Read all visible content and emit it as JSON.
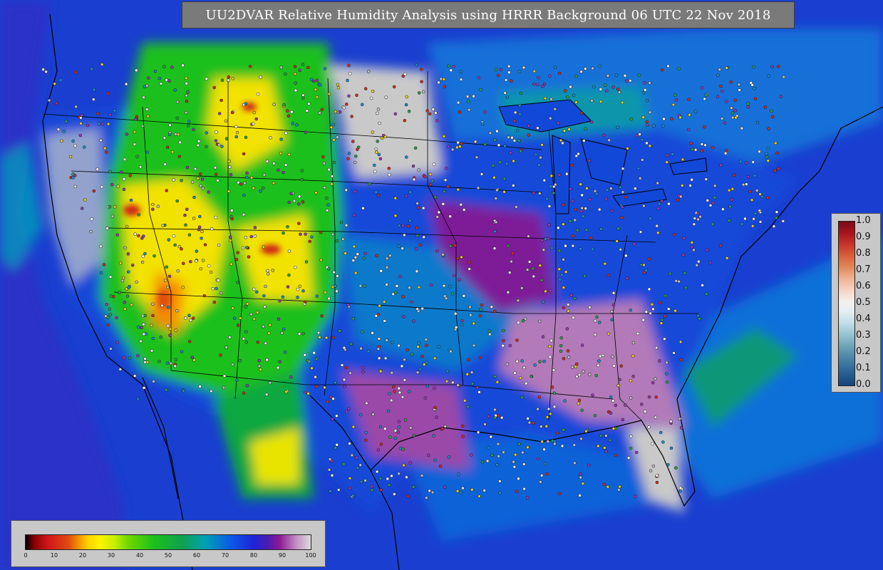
{
  "title": "UU2DVAR Relative Humidity Analysis using HRRR Background 06 UTC 22 Nov 2018",
  "colors": {
    "ocean": "#1a3fd0",
    "mid_humidity": "#1cc01c",
    "dry": "#f2e200",
    "very_dry": "#d02818",
    "saturated": "#c9c9c9",
    "purple": "#7e1e98"
  },
  "legend_right": {
    "ticks": [
      "1.0",
      "0.9",
      "0.8",
      "0.7",
      "0.6",
      "0.5",
      "0.4",
      "0.3",
      "0.2",
      "0.1",
      "0.0"
    ]
  },
  "legend_bottom": {
    "ticks": [
      "0",
      "10",
      "20",
      "30",
      "40",
      "50",
      "60",
      "70",
      "80",
      "90",
      "100"
    ]
  }
}
